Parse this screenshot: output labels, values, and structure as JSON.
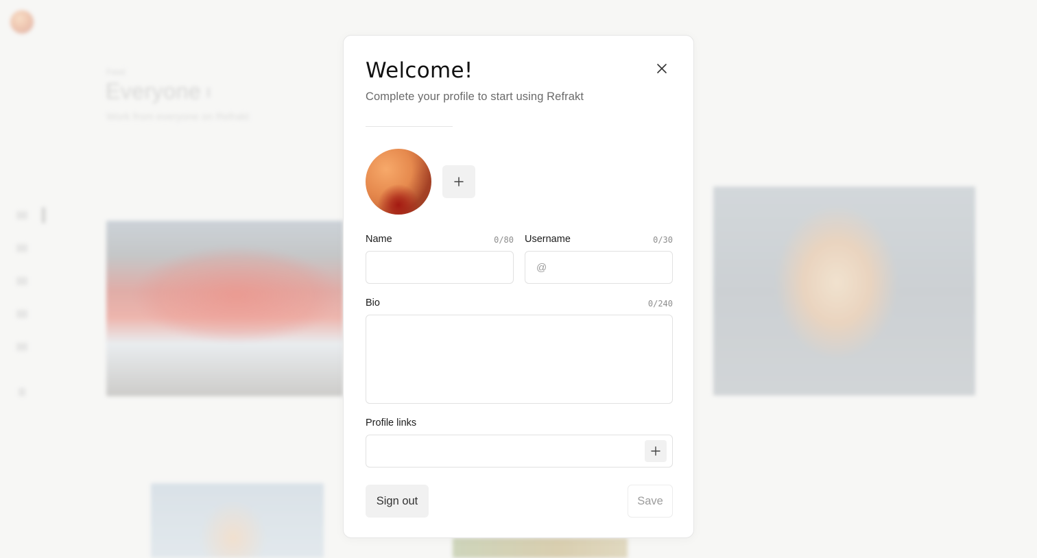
{
  "background": {
    "breadcrumb": "Feed",
    "title": "Everyone",
    "subtitle": "Work from everyone on Refrakt"
  },
  "modal": {
    "title": "Welcome!",
    "subtitle": "Complete your profile to start using Refrakt",
    "close_icon": "close-icon",
    "avatar_add_icon": "plus-icon",
    "fields": {
      "name": {
        "label": "Name",
        "counter": "0/80",
        "value": "",
        "placeholder": ""
      },
      "username": {
        "label": "Username",
        "counter": "0/30",
        "value": "",
        "placeholder": "@"
      },
      "bio": {
        "label": "Bio",
        "counter": "0/240",
        "value": "",
        "placeholder": ""
      },
      "links": {
        "label": "Profile links",
        "add_icon": "plus-icon"
      }
    },
    "actions": {
      "sign_out": "Sign out",
      "save": "Save"
    }
  },
  "colors": {
    "page_background": "#f6f6f5",
    "modal_background": "#ffffff",
    "muted_text": "#6a6a6a",
    "button_fill": "#f1f1f1"
  }
}
